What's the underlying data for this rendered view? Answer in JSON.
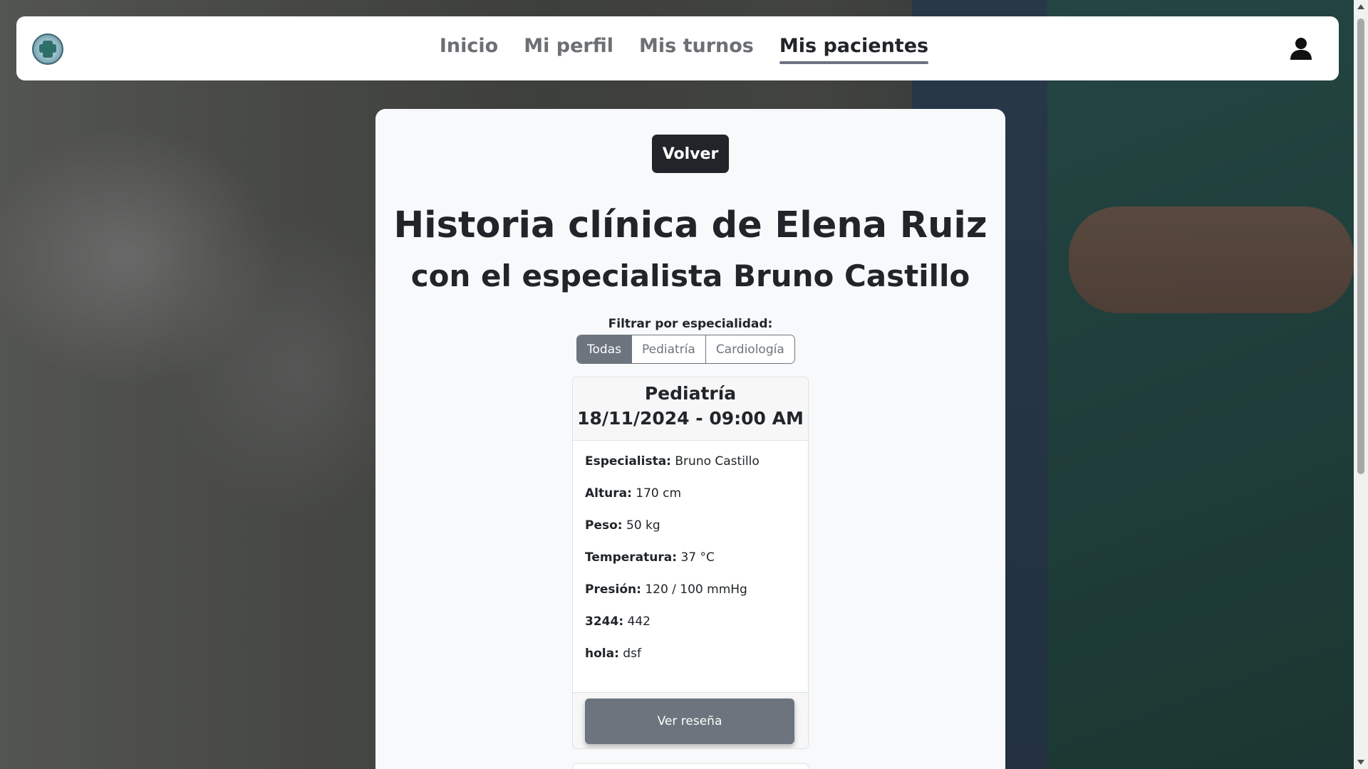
{
  "navbar": {
    "logo_icon": "clinic-logo-icon",
    "links": [
      {
        "label": "Inicio",
        "active": false
      },
      {
        "label": "Mi perfil",
        "active": false
      },
      {
        "label": "Mis turnos",
        "active": false
      },
      {
        "label": "Mis pacientes",
        "active": true
      }
    ],
    "user_icon": "user-icon"
  },
  "main": {
    "back_label": "Volver",
    "title": "Historia clínica de Elena Ruiz",
    "subtitle": "con el especialista Bruno Castillo",
    "filter": {
      "label": "Filtrar por especialidad:",
      "options": [
        {
          "label": "Todas",
          "active": true
        },
        {
          "label": "Pediatría",
          "active": false
        },
        {
          "label": "Cardiología",
          "active": false
        }
      ]
    },
    "records": [
      {
        "specialty": "Pediatría",
        "datetime": "18/11/2024 - 09:00 AM",
        "fields": [
          {
            "label": "Especialista:",
            "value": "Bruno Castillo"
          },
          {
            "label": "Altura:",
            "value": "170 cm"
          },
          {
            "label": "Peso:",
            "value": "50 kg"
          },
          {
            "label": "Temperatura:",
            "value": "37 °C"
          },
          {
            "label": "Presión:",
            "value": "120 / 100 mmHg"
          },
          {
            "label": "3244:",
            "value": "442"
          },
          {
            "label": "hola:",
            "value": "dsf"
          }
        ],
        "review_label": "Ver reseña"
      }
    ]
  },
  "colors": {
    "nav_active_underline": "#6c7480",
    "primary_dark": "#212529",
    "secondary": "#6c757d"
  }
}
